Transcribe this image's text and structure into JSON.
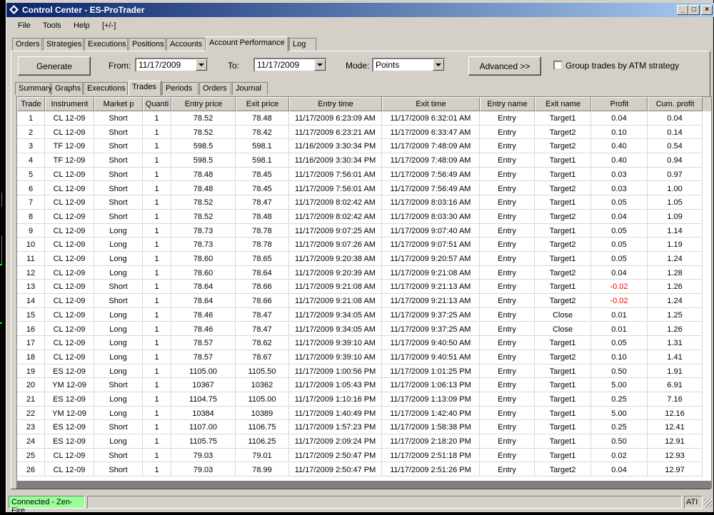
{
  "window": {
    "title": "Control Center - ES-ProTrader"
  },
  "menu": [
    "File",
    "Tools",
    "Help",
    "[+/-]"
  ],
  "main_tabs": [
    "Orders",
    "Strategies",
    "Executions",
    "Positions",
    "Accounts",
    "Account Performance",
    "Log"
  ],
  "controls": {
    "generate": "Generate",
    "from_label": "From:",
    "from_value": "11/17/2009",
    "to_label": "To:",
    "to_value": "11/17/2009",
    "mode_label": "Mode:",
    "mode_value": "Points",
    "advanced": "Advanced >>",
    "group_label": "Group trades by ATM strategy"
  },
  "sub_tabs": [
    "Summary",
    "Graphs",
    "Executions",
    "Trades",
    "Periods",
    "Orders",
    "Journal"
  ],
  "table": {
    "columns": [
      "Trade",
      "Instrument",
      "Market p",
      "Quanti",
      "Entry price",
      "Exit price",
      "Entry time",
      "Exit time",
      "Entry name",
      "Exit name",
      "Profit",
      "Cum. profit"
    ],
    "rows": [
      [
        "1",
        "CL 12-09",
        "Short",
        "1",
        "78.52",
        "78.48",
        "11/17/2009 6:23:09 AM",
        "11/17/2009 6:32:01 AM",
        "Entry",
        "Target1",
        "0.04",
        "0.04"
      ],
      [
        "2",
        "CL 12-09",
        "Short",
        "1",
        "78.52",
        "78.42",
        "11/17/2009 6:23:21 AM",
        "11/17/2009 6:33:47 AM",
        "Entry",
        "Target2",
        "0.10",
        "0.14"
      ],
      [
        "3",
        "TF 12-09",
        "Short",
        "1",
        "598.5",
        "598.1",
        "11/16/2009 3:30:34 PM",
        "11/17/2009 7:48:09 AM",
        "Entry",
        "Target2",
        "0.40",
        "0.54"
      ],
      [
        "4",
        "TF 12-09",
        "Short",
        "1",
        "598.5",
        "598.1",
        "11/16/2009 3:30:34 PM",
        "11/17/2009 7:48:09 AM",
        "Entry",
        "Target1",
        "0.40",
        "0.94"
      ],
      [
        "5",
        "CL 12-09",
        "Short",
        "1",
        "78.48",
        "78.45",
        "11/17/2009 7:56:01 AM",
        "11/17/2009 7:56:49 AM",
        "Entry",
        "Target1",
        "0.03",
        "0.97"
      ],
      [
        "6",
        "CL 12-09",
        "Short",
        "1",
        "78.48",
        "78.45",
        "11/17/2009 7:56:01 AM",
        "11/17/2009 7:56:49 AM",
        "Entry",
        "Target2",
        "0.03",
        "1.00"
      ],
      [
        "7",
        "CL 12-09",
        "Short",
        "1",
        "78.52",
        "78.47",
        "11/17/2009 8:02:42 AM",
        "11/17/2009 8:03:16 AM",
        "Entry",
        "Target1",
        "0.05",
        "1.05"
      ],
      [
        "8",
        "CL 12-09",
        "Short",
        "1",
        "78.52",
        "78.48",
        "11/17/2009 8:02:42 AM",
        "11/17/2009 8:03:30 AM",
        "Entry",
        "Target2",
        "0.04",
        "1.09"
      ],
      [
        "9",
        "CL 12-09",
        "Long",
        "1",
        "78.73",
        "78.78",
        "11/17/2009 9:07:25 AM",
        "11/17/2009 9:07:40 AM",
        "Entry",
        "Target1",
        "0.05",
        "1.14"
      ],
      [
        "10",
        "CL 12-09",
        "Long",
        "1",
        "78.73",
        "78.78",
        "11/17/2009 9:07:26 AM",
        "11/17/2009 9:07:51 AM",
        "Entry",
        "Target2",
        "0.05",
        "1.19"
      ],
      [
        "11",
        "CL 12-09",
        "Long",
        "1",
        "78.60",
        "78.65",
        "11/17/2009 9:20:38 AM",
        "11/17/2009 9:20:57 AM",
        "Entry",
        "Target1",
        "0.05",
        "1.24"
      ],
      [
        "12",
        "CL 12-09",
        "Long",
        "1",
        "78.60",
        "78.64",
        "11/17/2009 9:20:39 AM",
        "11/17/2009 9:21:08 AM",
        "Entry",
        "Target2",
        "0.04",
        "1.28"
      ],
      [
        "13",
        "CL 12-09",
        "Short",
        "1",
        "78.64",
        "78.66",
        "11/17/2009 9:21:08 AM",
        "11/17/2009 9:21:13 AM",
        "Entry",
        "Target1",
        "-0.02",
        "1.26"
      ],
      [
        "14",
        "CL 12-09",
        "Short",
        "1",
        "78.64",
        "78.66",
        "11/17/2009 9:21:08 AM",
        "11/17/2009 9:21:13 AM",
        "Entry",
        "Target2",
        "-0.02",
        "1.24"
      ],
      [
        "15",
        "CL 12-09",
        "Long",
        "1",
        "78.46",
        "78.47",
        "11/17/2009 9:34:05 AM",
        "11/17/2009 9:37:25 AM",
        "Entry",
        "Close",
        "0.01",
        "1.25"
      ],
      [
        "16",
        "CL 12-09",
        "Long",
        "1",
        "78.46",
        "78.47",
        "11/17/2009 9:34:05 AM",
        "11/17/2009 9:37:25 AM",
        "Entry",
        "Close",
        "0.01",
        "1.26"
      ],
      [
        "17",
        "CL 12-09",
        "Long",
        "1",
        "78.57",
        "78.62",
        "11/17/2009 9:39:10 AM",
        "11/17/2009 9:40:50 AM",
        "Entry",
        "Target1",
        "0.05",
        "1.31"
      ],
      [
        "18",
        "CL 12-09",
        "Long",
        "1",
        "78.57",
        "78.67",
        "11/17/2009 9:39:10 AM",
        "11/17/2009 9:40:51 AM",
        "Entry",
        "Target2",
        "0.10",
        "1.41"
      ],
      [
        "19",
        "ES 12-09",
        "Long",
        "1",
        "1105.00",
        "1105.50",
        "11/17/2009 1:00:56 PM",
        "11/17/2009 1:01:25 PM",
        "Entry",
        "Target1",
        "0.50",
        "1.91"
      ],
      [
        "20",
        "YM 12-09",
        "Short",
        "1",
        "10367",
        "10362",
        "11/17/2009 1:05:43 PM",
        "11/17/2009 1:06:13 PM",
        "Entry",
        "Target1",
        "5.00",
        "6.91"
      ],
      [
        "21",
        "ES 12-09",
        "Long",
        "1",
        "1104.75",
        "1105.00",
        "11/17/2009 1:10:16 PM",
        "11/17/2009 1:13:09 PM",
        "Entry",
        "Target1",
        "0.25",
        "7.16"
      ],
      [
        "22",
        "YM 12-09",
        "Long",
        "1",
        "10384",
        "10389",
        "11/17/2009 1:40:49 PM",
        "11/17/2009 1:42:40 PM",
        "Entry",
        "Target1",
        "5.00",
        "12.16"
      ],
      [
        "23",
        "ES 12-09",
        "Short",
        "1",
        "1107.00",
        "1106.75",
        "11/17/2009 1:57:23 PM",
        "11/17/2009 1:58:38 PM",
        "Entry",
        "Target1",
        "0.25",
        "12.41"
      ],
      [
        "24",
        "ES 12-09",
        "Long",
        "1",
        "1105.75",
        "1106.25",
        "11/17/2009 2:09:24 PM",
        "11/17/2009 2:18:20 PM",
        "Entry",
        "Target1",
        "0.50",
        "12.91"
      ],
      [
        "25",
        "CL 12-09",
        "Short",
        "1",
        "79.03",
        "79.01",
        "11/17/2009 2:50:47 PM",
        "11/17/2009 2:51:18 PM",
        "Entry",
        "Target1",
        "0.02",
        "12.93"
      ],
      [
        "26",
        "CL 12-09",
        "Short",
        "1",
        "79.03",
        "78.99",
        "11/17/2009 2:50:47 PM",
        "11/17/2009 2:51:26 PM",
        "Entry",
        "Target2",
        "0.04",
        "12.97"
      ]
    ]
  },
  "status": {
    "connection": "Connected - Zen-Fire",
    "right": "ATI"
  },
  "colors": {
    "title_start": "#0a246a",
    "title_end": "#a6caf0",
    "connected": "#99ff99",
    "negative": "#ff0000"
  }
}
